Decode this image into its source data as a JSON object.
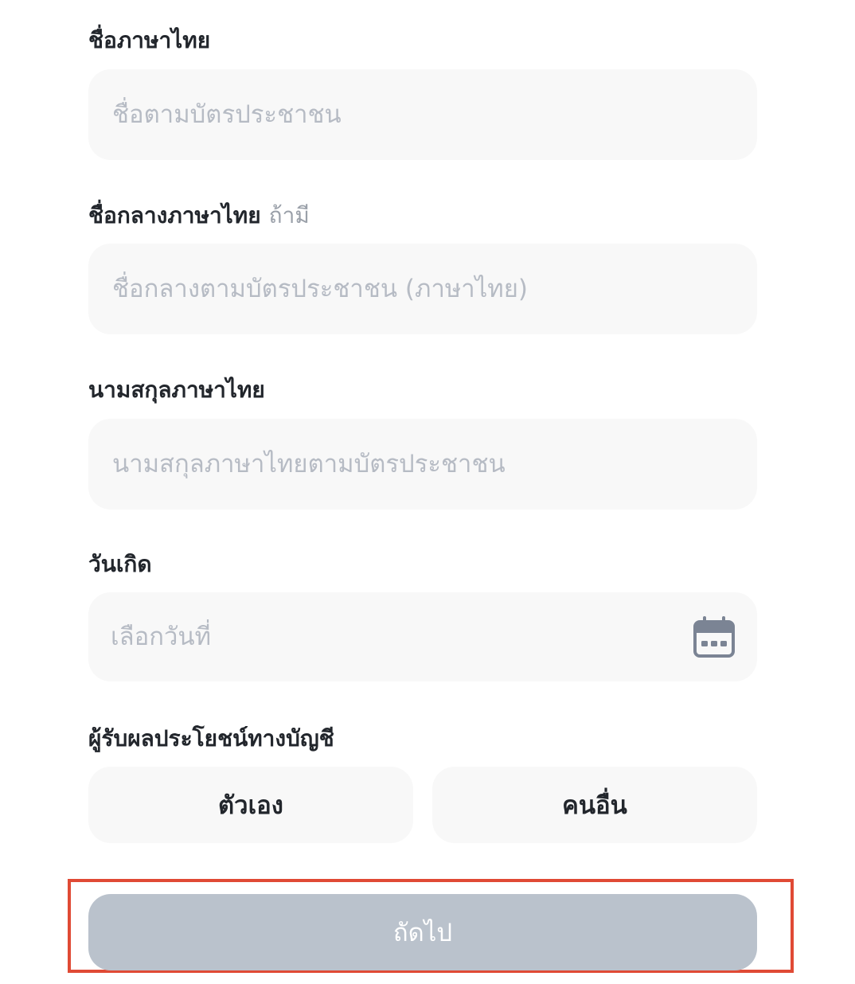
{
  "form": {
    "thai_first_name": {
      "label": "ชื่อภาษาไทย",
      "value": "",
      "placeholder": "ชื่อตามบัตรประชาชน"
    },
    "thai_middle_name": {
      "label": "ชื่อกลางภาษาไทย",
      "optional_hint": "ถ้ามี",
      "value": "",
      "placeholder": "ชื่อกลางตามบัตรประชาชน (ภาษาไทย)"
    },
    "thai_last_name": {
      "label": "นามสกุลภาษาไทย",
      "value": "",
      "placeholder": "นามสกุลภาษาไทยตามบัตรประชาชน"
    },
    "birth_date": {
      "label": "วันเกิด",
      "value": "",
      "placeholder": "เลือกวันที่",
      "icon": "calendar-icon"
    },
    "beneficiary": {
      "label": "ผู้รับผลประโยชน์ทางบัญชี",
      "options": [
        "ตัวเอง",
        "คนอื่น"
      ]
    },
    "next_label": "ถัดไป"
  },
  "colors": {
    "field_background": "#f8f8f8",
    "placeholder": "#b6bbc4",
    "label_text": "#22262c",
    "button_disabled": "#bac2cc",
    "highlight_border": "#e04a35",
    "icon": "#7b8494"
  }
}
